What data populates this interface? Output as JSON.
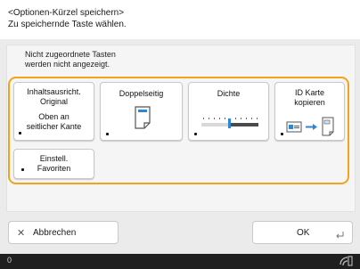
{
  "header": {
    "line1": "<Optionen-Kürzel speichern>",
    "line2": "Zu speichernde Taste wählen."
  },
  "note": {
    "line1": "Nicht zugeordnete Tasten",
    "line2": "werden nicht angezeigt."
  },
  "keys": {
    "original": {
      "line1": "Inhaltsausricht.",
      "line2": "Original",
      "line3": "Oben an",
      "line4": "seitlicher Kante"
    },
    "duplex": {
      "label": "Doppelseitig"
    },
    "density": {
      "label": "Dichte"
    },
    "id_card": {
      "line1": "ID Karte",
      "line2": "kopieren"
    },
    "favorites": {
      "line1": "Einstell.",
      "line2": "Favoriten"
    }
  },
  "footer": {
    "cancel_icon": "✕",
    "cancel_label": "Abbrechen",
    "ok_label": "OK"
  },
  "status": {
    "left": "0"
  },
  "colors": {
    "accent": "#f2a31a",
    "background": "#ebebeb",
    "statusbar": "#1f1f1f"
  }
}
